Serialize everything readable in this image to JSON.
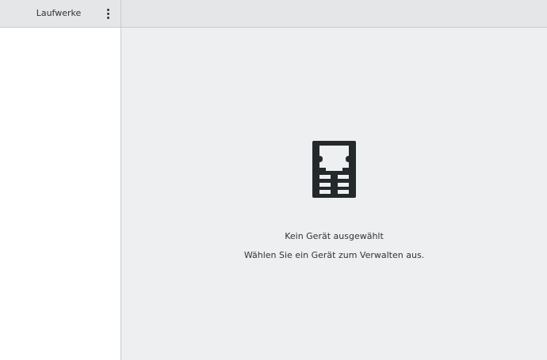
{
  "sidebar": {
    "title": "Laufwerke",
    "menu_icon": "vertical-ellipsis-icon",
    "items": []
  },
  "main": {
    "empty_state": {
      "icon": "memory-card-icon",
      "title": "Kein Gerät ausgewählt",
      "subtitle": "Wählen Sie ein Gerät zum Verwalten aus."
    }
  },
  "colors": {
    "header_bg": "#e5e6e7",
    "main_bg": "#eeeff1",
    "sidebar_bg": "#ffffff",
    "border": "#c9cbcd",
    "icon": "#24292b",
    "text": "#2e3436"
  }
}
